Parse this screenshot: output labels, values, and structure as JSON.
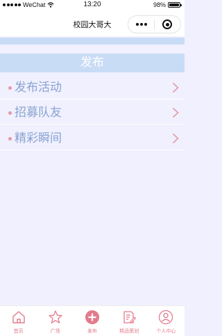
{
  "status_bar": {
    "carrier": "WeChat",
    "time": "13:20",
    "battery": "98%",
    "battery_level": 0.98
  },
  "nav_bar": {
    "title": "校园大哥大"
  },
  "section": {
    "title": "发布"
  },
  "menu": [
    {
      "label": "发布活动"
    },
    {
      "label": "招募队友"
    },
    {
      "label": "精彩瞬间"
    }
  ],
  "tab_bar": [
    {
      "label": "首页",
      "icon": "home-icon"
    },
    {
      "label": "广场",
      "icon": "star-icon"
    },
    {
      "label": "发布",
      "icon": "plus-circle-icon"
    },
    {
      "label": "精品策划",
      "icon": "document-pen-icon"
    },
    {
      "label": "个人中心",
      "icon": "user-icon"
    }
  ],
  "colors": {
    "header_blue": "#c9dcf6",
    "page_bg": "#f0f0ff",
    "label_blue": "#8aa3d0",
    "accent_pink": "#e39aa5"
  }
}
